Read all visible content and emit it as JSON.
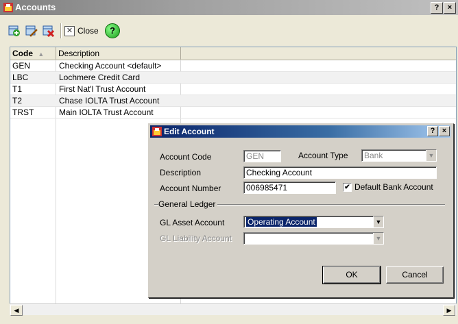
{
  "window": {
    "title": "Accounts"
  },
  "toolbar": {
    "close_label": "Close",
    "help_glyph": "?"
  },
  "grid": {
    "headers": [
      "Code",
      "Description"
    ],
    "rows": [
      {
        "code": "GEN",
        "description": "Checking Account <default>"
      },
      {
        "code": "LBC",
        "description": "Lochmere Credit Card"
      },
      {
        "code": "T1",
        "description": "First Nat'l Trust Account"
      },
      {
        "code": "T2",
        "description": "Chase IOLTA Trust Account"
      },
      {
        "code": "TRST",
        "description": "Main IOLTA Trust Account"
      }
    ]
  },
  "dialog": {
    "title": "Edit Account",
    "account_code_label": "Account Code",
    "account_code_value": "GEN",
    "account_type_label": "Account Type",
    "account_type_value": "Bank",
    "description_label": "Description",
    "description_value": "Checking Account",
    "account_number_label": "Account Number",
    "account_number_value": "006985471",
    "default_bank_label": "Default Bank Account",
    "default_bank_checked": true,
    "general_ledger_label": "General Ledger",
    "gl_asset_label": "GL Asset Account",
    "gl_asset_value": "Operating Account",
    "gl_liability_label": "GL Liability Account",
    "gl_liability_value": "",
    "ok_label": "OK",
    "cancel_label": "Cancel"
  },
  "icons": [
    "app-logo-icon",
    "add-record-icon",
    "edit-record-icon",
    "delete-record-icon",
    "close-x-icon",
    "help-icon",
    "sort-up-icon",
    "scroll-left-icon",
    "scroll-right-icon",
    "dropdown-arrow-icon",
    "checkmark-icon"
  ]
}
